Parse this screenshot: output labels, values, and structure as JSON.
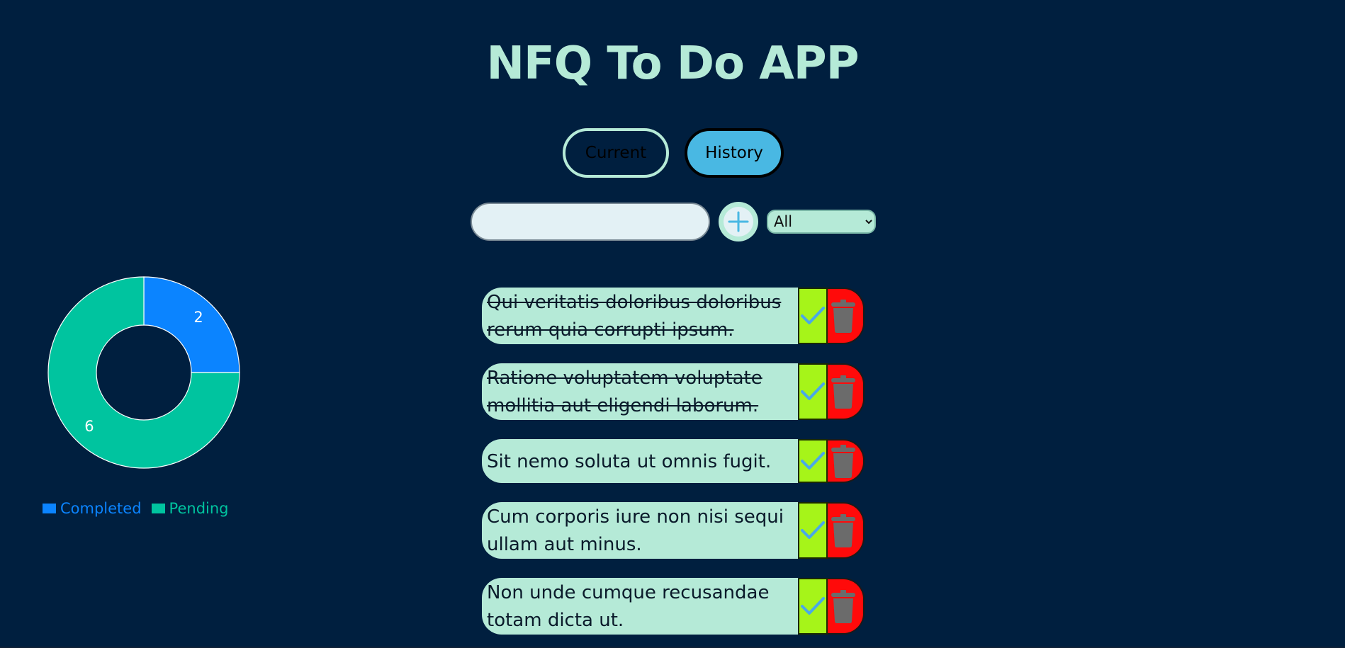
{
  "app": {
    "title": "NFQ To Do APP"
  },
  "tabs": {
    "current_label": "Current",
    "history_label": "History",
    "active": "History"
  },
  "toolbar": {
    "input_value": "",
    "add_icon": "plus-icon",
    "filter_selected": "All",
    "filter_options": [
      "All"
    ]
  },
  "tasks": [
    {
      "text": "Qui veritatis doloribus doloribus rerum quia corrupti ipsum.",
      "completed": true
    },
    {
      "text": "Ratione voluptatem voluptate mollitia aut eligendi laborum.",
      "completed": true
    },
    {
      "text": "Sit nemo soluta ut omnis fugit.",
      "completed": false
    },
    {
      "text": "Cum corporis iure non nisi sequi ullam aut minus.",
      "completed": false
    },
    {
      "text": "Non unde cumque recusandae totam dicta ut.",
      "completed": false
    }
  ],
  "task_actions": {
    "complete_icon": "checkmark-icon",
    "delete_icon": "trash-icon"
  },
  "colors": {
    "background": "#001f3f",
    "accent": "#b5ead7",
    "history_tab": "#49b8e3",
    "check_button": "#a6f419",
    "delete_button": "#ff0a0a",
    "completed": "#0b84ff",
    "pending": "#00c49f"
  },
  "chart_data": {
    "type": "pie",
    "donut": true,
    "categories": [
      "Completed",
      "Pending"
    ],
    "values": [
      2,
      6
    ],
    "colors": [
      "#0b84ff",
      "#00c49f"
    ],
    "data_labels": [
      "2",
      "6"
    ],
    "legend_position": "bottom-left",
    "legend": [
      "Completed",
      "Pending"
    ]
  }
}
